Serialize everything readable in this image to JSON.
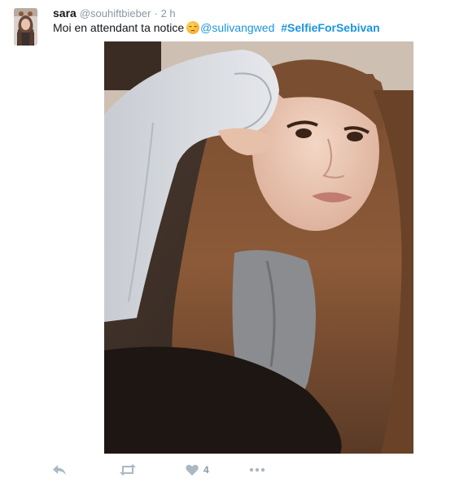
{
  "tweet": {
    "user": {
      "name": "sara",
      "handle": "@souhiftbieber",
      "separator": "·",
      "time": "2 h"
    },
    "text": {
      "body": "Moi en attendant ta notice",
      "emoji": "disappointed-face",
      "mention": "@sulivangwed",
      "hashtag": "#SelfieForSebivan"
    },
    "actions": {
      "reply": "reply-icon",
      "retweet": "retweet-icon",
      "like": "heart-icon",
      "like_count": "4",
      "more": "more-icon"
    },
    "colors": {
      "link": "#1b95e0",
      "muted": "#8899a6",
      "icon": "#aab8c2",
      "text": "#14171a"
    }
  }
}
